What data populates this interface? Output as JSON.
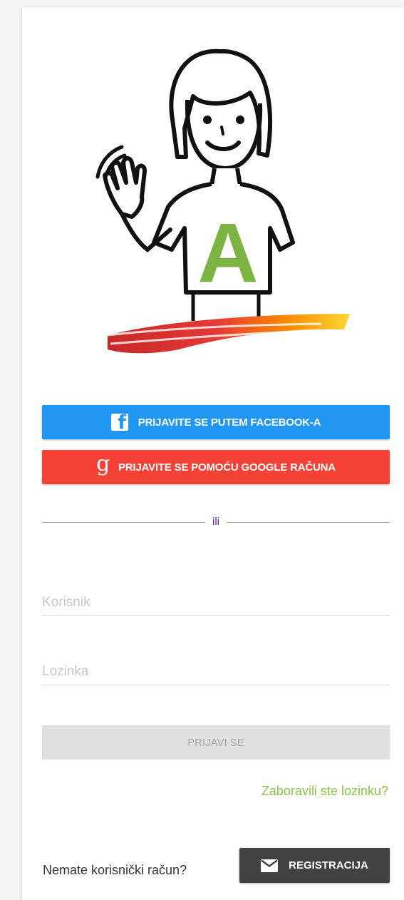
{
  "colors": {
    "facebook": "#2196f3",
    "google": "#f44336",
    "accent_link": "#8bc34a",
    "divider_text": "#6a1b9a",
    "register_bg": "#424242",
    "logo_letter": "#7cb342"
  },
  "logo": {
    "letter": "A",
    "icon": "waving-child-logo"
  },
  "social": {
    "facebook_label": "PRIJAVITE SE PUTEM FACEBOOK-A",
    "facebook_icon_glyph": "f",
    "google_label": "PRIJAVITE SE POMOĆU GOOGLE RAČUNA",
    "google_icon_glyph": "g"
  },
  "divider": {
    "text": "ili"
  },
  "form": {
    "username_placeholder": "Korisnik",
    "username_value": "",
    "password_placeholder": "Lozinka",
    "password_value": "",
    "login_label": "PRIJAVI SE",
    "forgot_label": "Zaboravili ste lozinku?"
  },
  "register": {
    "prompt": "Nemate korisnički račun?",
    "button_label": "REGISTRACIJA",
    "icon": "mail-icon"
  }
}
